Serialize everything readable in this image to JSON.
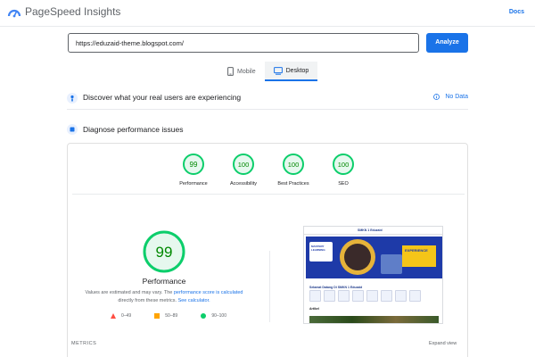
{
  "header": {
    "app_title": "PageSpeed Insights",
    "docs_label": "Docs",
    "logo_icon": "pagespeed-logo-icon"
  },
  "search": {
    "url_value": "https://eduzaid-theme.blogspot.com/",
    "analyze_label": "Analyze"
  },
  "tabs": [
    {
      "label": "Mobile",
      "icon": "mobile-icon",
      "active": false
    },
    {
      "label": "Desktop",
      "icon": "desktop-icon",
      "active": true
    }
  ],
  "crux": {
    "title": "Discover what your real users are experiencing",
    "status": "No Data"
  },
  "diagnose": {
    "title": "Diagnose performance issues"
  },
  "scores": [
    {
      "label": "Performance",
      "value": "99"
    },
    {
      "label": "Accessibility",
      "value": "100"
    },
    {
      "label": "Best Practices",
      "value": "100"
    },
    {
      "label": "SEO",
      "value": "100"
    }
  ],
  "performance": {
    "score": "99",
    "title": "Performance",
    "note_prefix": "Values are estimated and may vary. The",
    "note_link1": "performance score is calculated",
    "note_middle": "directly from these metrics.",
    "note_link2": "See calculator."
  },
  "legend": [
    {
      "range": "0–49",
      "color": "#ff4e42"
    },
    {
      "range": "50–89",
      "color": "#ffa400"
    },
    {
      "range": "90–100",
      "color": "#0cce6b"
    }
  ],
  "screenshot": {
    "nav_text": "SMKN 1 Eduzaid",
    "hero_left": "MASTERY LEARNING",
    "hero_right": "EXPERIENCE",
    "section_title": "Selamat Datang Di SMKN 1 Eduzaid",
    "artikel": "Artikel"
  },
  "footer": {
    "metrics_label": "METRICS",
    "expand_label": "Expand view"
  },
  "colors": {
    "accent": "#1a73e8",
    "pass": "#0cce6b",
    "pass_text": "#008800",
    "pass_bg": "#e6f8ee"
  }
}
